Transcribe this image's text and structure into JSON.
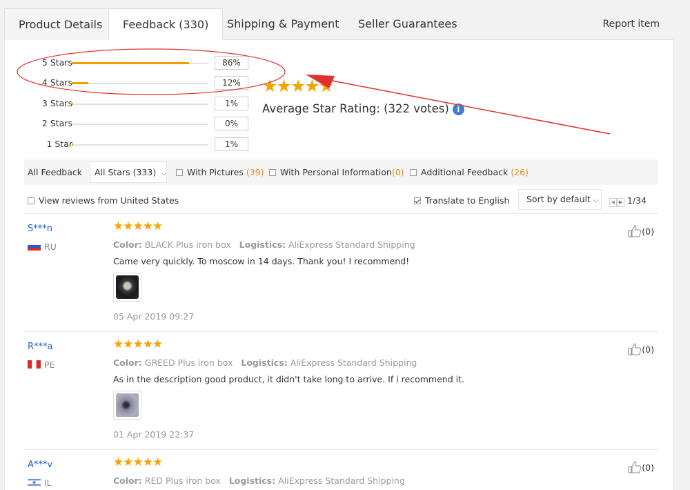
{
  "tabs": [
    {
      "label": "Product Details"
    },
    {
      "label": "Feedback (330)"
    },
    {
      "label": "Shipping & Payment"
    },
    {
      "label": "Seller Guarantees"
    }
  ],
  "report_label": "Report item",
  "ratings": [
    {
      "label": "5 Stars",
      "percent": "86%",
      "fill": 0.86
    },
    {
      "label": "4 Stars",
      "percent": "12%",
      "fill": 0.12
    },
    {
      "label": "3 Stars",
      "percent": "1%",
      "fill": 0.01
    },
    {
      "label": "2 Stars",
      "percent": "0%",
      "fill": 0.0
    },
    {
      "label": "1 Star",
      "percent": "1%",
      "fill": 0.01
    }
  ],
  "average": {
    "stars": "★★★★★",
    "text": "Average Star Rating:  (322 votes)",
    "info_glyph": "i"
  },
  "filters": {
    "all_feedback": "All Feedback",
    "all_stars": "All Stars (333)",
    "with_pictures": "With Pictures",
    "with_pictures_count": "(39)",
    "with_personal": "With Personal Information",
    "with_personal_count": "(0)",
    "additional": "Additional Feedback",
    "additional_count": "(26)"
  },
  "options": {
    "view_us": "View reviews from United States",
    "translate": "Translate to English",
    "sort": "Sort by default",
    "page": "1/34"
  },
  "reviews": [
    {
      "user": "S***n",
      "country": "RU",
      "stars": "★★★★★",
      "color_label": "Color:",
      "color": "BLACK Plus iron box",
      "logistics_label": "Logistics:",
      "logistics": "AliExpress Standard Shipping",
      "text": "Came very quickly. To moscow in 14 days. Thank you! I recommend!",
      "date": "05 Apr 2019 09:27",
      "helpful": "(0)"
    },
    {
      "user": "R***a",
      "country": "PE",
      "stars": "★★★★★",
      "color_label": "Color:",
      "color": "GREED Plus iron box",
      "logistics_label": "Logistics:",
      "logistics": "AliExpress Standard Shipping",
      "text": "As in the description good product, it didn't take long to arrive. If i recommend it.",
      "date": "01 Apr 2019 22:37",
      "helpful": "(0)"
    },
    {
      "user": "A***v",
      "country": "IL",
      "stars": "★★★★★",
      "color_label": "Color:",
      "color": "RED Plus iron box",
      "logistics_label": "Logistics:",
      "logistics": "AliExpress Standard Shipping",
      "text": "",
      "date": "",
      "helpful": "(0)"
    }
  ],
  "colors": {
    "star": "#f5a300",
    "bar_fill": "#f0a000",
    "username": "#1d5fc4",
    "count": "#e08a1c",
    "annotation": "#e03030",
    "info": "#3d7fd6"
  }
}
